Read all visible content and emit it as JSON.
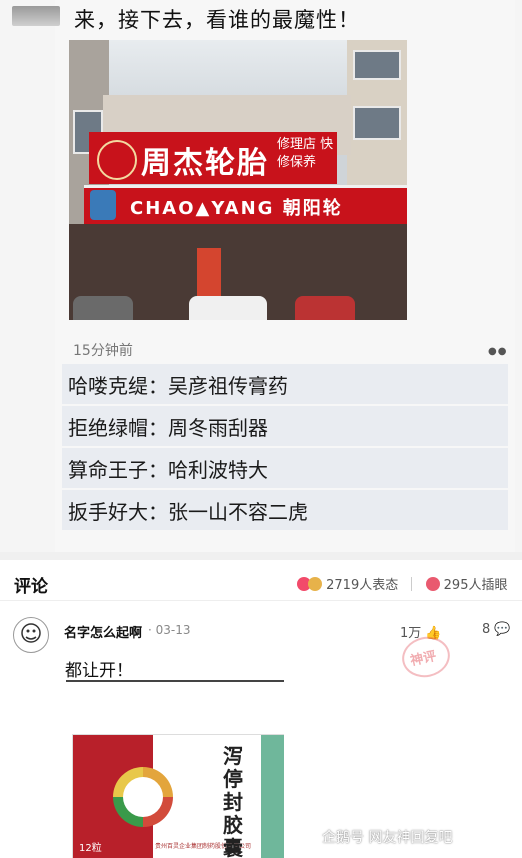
{
  "post": {
    "title": "来，接下去，看谁的最魔性！",
    "time": "15分钟前",
    "more_icon": "dots-icon",
    "photo_signs": {
      "shop_name": "周杰轮胎",
      "shop_sub": "修理店 快修保养",
      "brand_banner": "CHAO▲YANG 朝阳轮"
    },
    "lines": [
      "哈喽克缇：吴彦祖传膏药",
      "拒绝绿帽：周冬雨刮器",
      "算命王子：哈利波特大",
      "扳手好大：张一山不容二虎"
    ]
  },
  "comments_header": {
    "label": "评论",
    "reactions": "2719人表态",
    "plugs": "295人插眼"
  },
  "comment": {
    "user": "名字怎么起啊",
    "date": "· 03-13",
    "likes": "1万",
    "replies": "8",
    "stamp": "神评",
    "text": "都让开！",
    "image": {
      "product": "泻停封胶囊",
      "pill_count": "12粒",
      "maker": "贵州百灵企业集团制药股份有限公司"
    }
  },
  "watermark": "企鹅号 网友神回复吧",
  "colors": {
    "sign_red": "#c8121b",
    "stamp_red": "#e04650",
    "comment_bg": "#e9ecf1"
  }
}
